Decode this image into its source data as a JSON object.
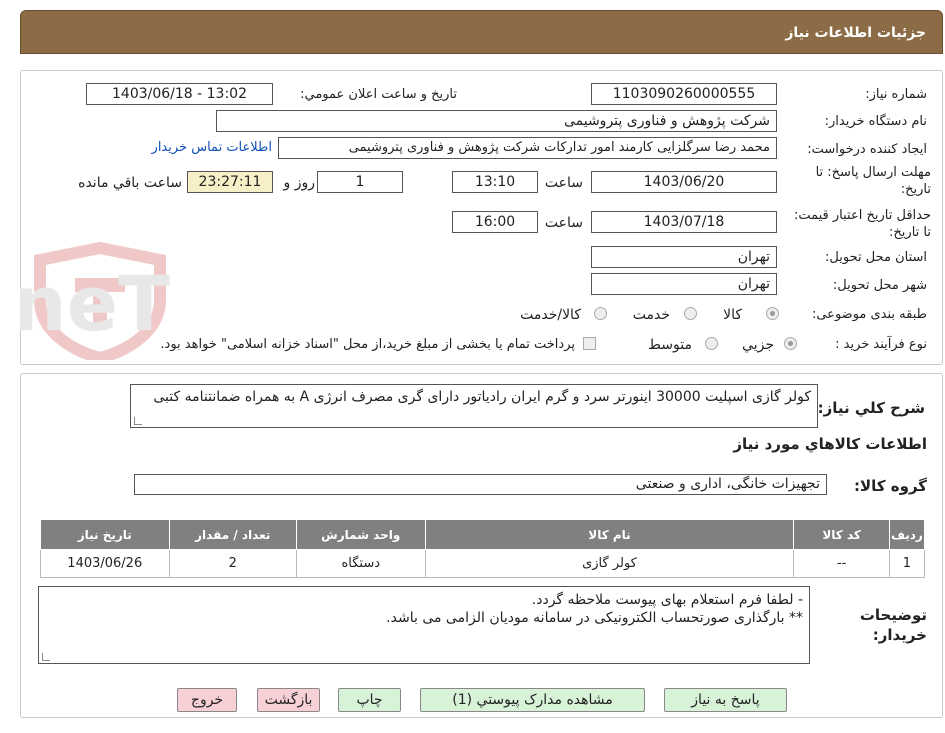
{
  "header": {
    "title": "جزئیات اطلاعات نیاز"
  },
  "info": {
    "need_no_label": "شماره نیاز:",
    "need_no": "1103090260000555",
    "announce_label": "تاریخ و ساعت اعلان عمومي:",
    "announce_value": "1403/06/18 - 13:02",
    "buyer_org_label": "نام دستگاه خريدار:",
    "buyer_org": "شرکت پژوهش و فناوری پتروشیمی",
    "creator_label": "ايجاد کننده درخواست:",
    "creator": "محمد رضا سرگلزایی کارمند امور تدارکات شرکت پژوهش و فناوری پتروشیمی",
    "contact_link": "اطلاعات تماس خريدار",
    "deadline_label": "مهلت ارسال پاسخ: تا تاریخ:",
    "deadline_date": "1403/06/20",
    "time_label": "ساعت",
    "deadline_time": "13:10",
    "days": "1",
    "days_label": "روز و",
    "remaining": "23:27:11",
    "remaining_label": "ساعت باقي مانده",
    "validity_label": "حداقل تاريخ اعتبار قيمت: تا تاریخ:",
    "validity_date": "1403/07/18",
    "validity_time": "16:00",
    "province_label": "استان محل تحويل:",
    "province": "تهران",
    "city_label": "شهر محل تحويل:",
    "city": "تهران",
    "category_label": "طبقه بندی موضوعی:",
    "category_options": [
      "کالا",
      "خدمت",
      "کالا/خدمت"
    ],
    "process_label": "نوع فرآيند خريد :",
    "process_options": [
      "جزيي",
      "متوسط"
    ],
    "payment_note": "پرداخت تمام يا بخشی از مبلغ خريد،از محل \"اسناد خزانه اسلامی\" خواهد بود."
  },
  "watermark": {
    "text": "AriaTender.neT"
  },
  "desc": {
    "label": "شرح کلي نياز:",
    "value": "کولر گازی اسپلیت 30000 اینورتر سرد و گرم ایران رادیاتور دارای گری مصرف انرژی A به همراه ضمانتنامه کتبی"
  },
  "goods": {
    "heading": "اطلاعات کالاهاي مورد نياز",
    "group_label": "گروه کالا:",
    "group_value": "تجهیزات خانگی، اداری و صنعتی",
    "columns": [
      "رديف",
      "کد کالا",
      "نام کالا",
      "واحد شمارش",
      "تعداد / مقدار",
      "تاريخ نياز"
    ],
    "rows": [
      [
        "1",
        "--",
        "کولر گازی",
        "دستگاه",
        "2",
        "1403/06/26"
      ]
    ]
  },
  "notes": {
    "label": "توضيحات خريدار:",
    "line1": "- لطفا فرم استعلام بهای پیوست ملاحظه گردد.",
    "line2": "** بارگذاری صورتحساب الکترونیکی در سامانه مودیان الزامی می باشد."
  },
  "buttons": {
    "reply": "پاسخ به نياز",
    "attachments": "مشاهده مدارک پيوستي (1)",
    "print": "چاپ",
    "back": "بازگشت",
    "exit": "خروج"
  },
  "colors": {
    "header": "#8c6c46",
    "button_green": "#d8f2d8",
    "button_red": "#f6d0d4",
    "link": "#1050b8"
  }
}
